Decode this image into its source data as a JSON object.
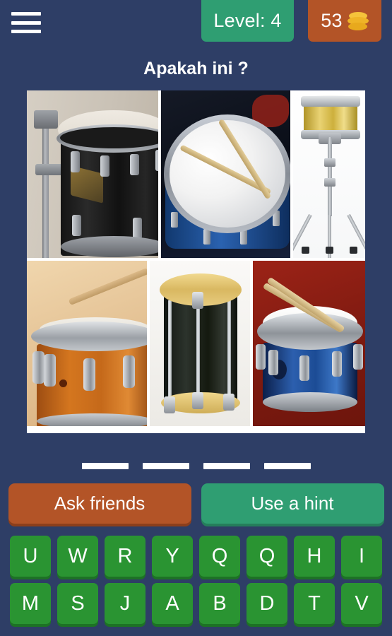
{
  "header": {
    "menu_icon": "hamburger-menu-icon",
    "level_label": "Level: 4",
    "coins_count": "53",
    "coins_icon": "coin-stack-icon",
    "level_badge_color": "#2f9e72",
    "coins_badge_color": "#b35427"
  },
  "question": {
    "text": "Apakah ini ?"
  },
  "collage": {
    "description": "six-photo drum collage",
    "tiles": [
      {
        "name": "black-tom-drum-on-stand",
        "position": "top-left"
      },
      {
        "name": "blue-drum-top-view-with-drumsticks",
        "position": "top-center"
      },
      {
        "name": "brass-snare-drum-on-tripod-stand",
        "position": "top-right"
      },
      {
        "name": "orange-wood-snare-drum",
        "position": "bottom-left"
      },
      {
        "name": "black-field-drum-with-wooden-hoops",
        "position": "bottom-center"
      },
      {
        "name": "blue-snare-drum-with-drumsticks",
        "position": "bottom-right"
      }
    ]
  },
  "answer": {
    "blanks": [
      "",
      "",
      "",
      ""
    ],
    "length": 4
  },
  "buttons": {
    "ask_friends": "Ask friends",
    "use_hint": "Use a hint",
    "ask_color": "#b35427",
    "hint_color": "#2f9e72"
  },
  "keyboard": {
    "key_color": "#2a9432",
    "rows": [
      [
        "U",
        "W",
        "R",
        "Y",
        "Q",
        "Q",
        "H",
        "I"
      ],
      [
        "M",
        "S",
        "J",
        "A",
        "B",
        "D",
        "T",
        "V"
      ]
    ]
  },
  "theme": {
    "background": "#2e3e66"
  }
}
